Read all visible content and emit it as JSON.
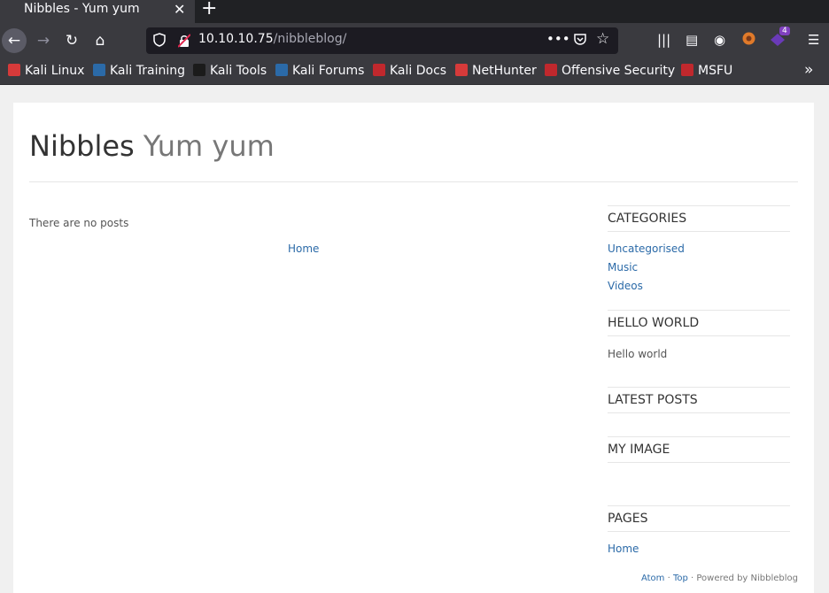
{
  "browser": {
    "tab": {
      "title": "Nibbles - Yum yum",
      "close": "✕"
    },
    "new_tab": "+",
    "nav": {
      "back": "←",
      "forward": "→",
      "reload": "↻",
      "home": "⌂"
    },
    "url": {
      "host": "10.10.10.75",
      "path": "/nibbleblog/",
      "more": "•••",
      "star": "☆"
    },
    "toolbar": {
      "library": "|||",
      "sidebar": "▤",
      "account": "◉",
      "menu": "☰",
      "ext_badge": "4"
    },
    "bookmarks": [
      {
        "label": "Kali Linux",
        "icon": "kali-linux-icon",
        "color": "#d63a3a"
      },
      {
        "label": "Kali Training",
        "icon": "kali-training-icon",
        "color": "#2b6aa8"
      },
      {
        "label": "Kali Tools",
        "icon": "kali-tools-icon",
        "color": "#1b1b1b"
      },
      {
        "label": "Kali Forums",
        "icon": "kali-forums-icon",
        "color": "#2b6aa8"
      },
      {
        "label": "Kali Docs",
        "icon": "kali-docs-icon",
        "color": "#c0282d"
      },
      {
        "label": "NetHunter",
        "icon": "nethunter-icon",
        "color": "#d63a3a"
      },
      {
        "label": "Offensive Security",
        "icon": "offsec-icon",
        "color": "#c0282d"
      },
      {
        "label": "MSFU",
        "icon": "msfu-icon",
        "color": "#c0282d"
      }
    ],
    "bookmarks_overflow": "»"
  },
  "site": {
    "name": "Nibbles",
    "slogan": "Yum yum",
    "no_posts": "There are no posts",
    "pager_home": "Home",
    "sidebar": {
      "categories": {
        "heading": "CATEGORIES",
        "items": [
          "Uncategorised",
          "Music",
          "Videos"
        ]
      },
      "hello": {
        "heading": "HELLO WORLD",
        "text": "Hello world"
      },
      "latest": {
        "heading": "LATEST POSTS"
      },
      "image": {
        "heading": "MY IMAGE"
      },
      "pages": {
        "heading": "PAGES",
        "items": [
          "Home"
        ]
      }
    },
    "footer": {
      "atom": "Atom",
      "sep1": " · ",
      "top": "Top",
      "powered": " · Powered by Nibbleblog"
    }
  },
  "colors": {
    "link": "#2b6aa8",
    "chrome": "#3a3a3f",
    "tabstrip": "#202124"
  }
}
